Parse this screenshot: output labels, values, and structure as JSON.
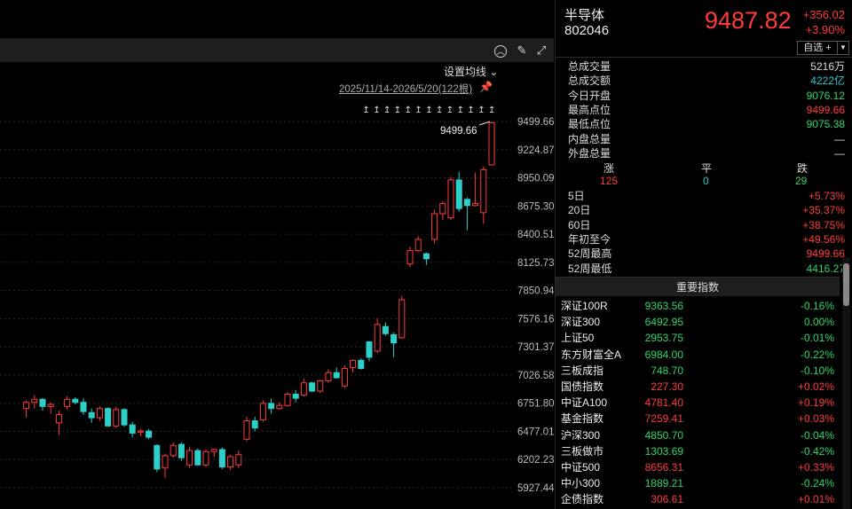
{
  "toolbar": {
    "collapse_icon": "collapse-up-icon",
    "draw_icon": "draw-pen-icon",
    "expand_icon": "expand-icon",
    "ma_setting_label": "设置均线",
    "date_range": "2025/11/14-2026/5/20(122根)"
  },
  "quote": {
    "name": "半导体",
    "code": "802046",
    "price": "9487.82",
    "change": "+356.02",
    "change_pct": "+3.90%",
    "watch_label": "自选 +",
    "watch_drop": "▼"
  },
  "stats": [
    {
      "label": "总成交量",
      "value": "5216万",
      "color": "flat"
    },
    {
      "label": "总成交额",
      "value": "4222亿",
      "color": "cyan"
    },
    {
      "label": "今日开盘",
      "value": "9076.12",
      "color": "down"
    },
    {
      "label": "最高点位",
      "value": "9499.66",
      "color": "up"
    },
    {
      "label": "最低点位",
      "value": "9075.38",
      "color": "down"
    },
    {
      "label": "内盘总量",
      "value": "—",
      "color": "flat"
    },
    {
      "label": "外盘总量",
      "value": "—",
      "color": "flat"
    }
  ],
  "breadth": {
    "up_label": "涨",
    "up_value": "125",
    "flat_label": "平",
    "flat_value": "0",
    "down_label": "跌",
    "down_value": "29"
  },
  "performance": [
    {
      "label": "5日",
      "value": "+5.73%",
      "color": "up"
    },
    {
      "label": "20日",
      "value": "+35.37%",
      "color": "up"
    },
    {
      "label": "60日",
      "value": "+38.75%",
      "color": "up"
    },
    {
      "label": "年初至今",
      "value": "+49.56%",
      "color": "up"
    },
    {
      "label": "52周最高",
      "value": "9499.66",
      "color": "up"
    },
    {
      "label": "52周最低",
      "value": "4416.27",
      "color": "down"
    }
  ],
  "indices_header": "重要指数",
  "indices": [
    {
      "name": "深证100R",
      "price": "9363.56",
      "change": "-0.16%",
      "color": "down"
    },
    {
      "name": "深证300",
      "price": "6492.95",
      "change": "0.00%",
      "color": "down"
    },
    {
      "name": "上证50",
      "price": "2953.75",
      "change": "-0.01%",
      "color": "down"
    },
    {
      "name": "东方财富全A",
      "price": "6984.00",
      "change": "-0.22%",
      "color": "down"
    },
    {
      "name": "三板成指",
      "price": "748.70",
      "change": "-0.10%",
      "color": "down"
    },
    {
      "name": "国债指数",
      "price": "227.30",
      "change": "+0.02%",
      "color": "up"
    },
    {
      "name": "中证A100",
      "price": "4781.40",
      "change": "+0.19%",
      "color": "up"
    },
    {
      "name": "基金指数",
      "price": "7259.41",
      "change": "+0.03%",
      "color": "up"
    },
    {
      "name": "沪深300",
      "price": "4850.70",
      "change": "-0.04%",
      "color": "down"
    },
    {
      "name": "三板做市",
      "price": "1303.69",
      "change": "-0.42%",
      "color": "down"
    },
    {
      "name": "中证500",
      "price": "8656.31",
      "change": "+0.33%",
      "color": "up"
    },
    {
      "name": "中小300",
      "price": "1889.21",
      "change": "-0.24%",
      "color": "down"
    },
    {
      "name": "企债指数",
      "price": "306.61",
      "change": "+0.01%",
      "color": "up"
    }
  ],
  "colors": {
    "up": "#ff3b3b",
    "down": "#2cd0c8",
    "grid": "#2a2a2a",
    "axis_text": "#bbbbbb"
  },
  "chart_data": {
    "type": "candlestick",
    "y_ticks": [
      9499.66,
      9224.87,
      8950.09,
      8675.3,
      8400.51,
      8125.73,
      7850.94,
      7576.16,
      7301.37,
      7026.58,
      6751.8,
      6477.01,
      6202.23,
      5927.44
    ],
    "ylim": [
      5880,
      9560
    ],
    "high_marker": "9499.66",
    "candles": [
      {
        "o": 6700,
        "h": 6780,
        "l": 6610,
        "c": 6760
      },
      {
        "o": 6760,
        "h": 6830,
        "l": 6700,
        "c": 6790
      },
      {
        "o": 6790,
        "h": 6800,
        "l": 6680,
        "c": 6720
      },
      {
        "o": 6720,
        "h": 6760,
        "l": 6650,
        "c": 6740
      },
      {
        "o": 6560,
        "h": 6680,
        "l": 6440,
        "c": 6640
      },
      {
        "o": 6720,
        "h": 6820,
        "l": 6690,
        "c": 6790
      },
      {
        "o": 6790,
        "h": 6810,
        "l": 6740,
        "c": 6760
      },
      {
        "o": 6760,
        "h": 6800,
        "l": 6640,
        "c": 6670
      },
      {
        "o": 6660,
        "h": 6700,
        "l": 6560,
        "c": 6610
      },
      {
        "o": 6610,
        "h": 6720,
        "l": 6580,
        "c": 6700
      },
      {
        "o": 6700,
        "h": 6710,
        "l": 6520,
        "c": 6530
      },
      {
        "o": 6530,
        "h": 6720,
        "l": 6510,
        "c": 6690
      },
      {
        "o": 6690,
        "h": 6700,
        "l": 6520,
        "c": 6540
      },
      {
        "o": 6540,
        "h": 6570,
        "l": 6420,
        "c": 6460
      },
      {
        "o": 6470,
        "h": 6500,
        "l": 6430,
        "c": 6480
      },
      {
        "o": 6480,
        "h": 6500,
        "l": 6400,
        "c": 6420
      },
      {
        "o": 6340,
        "h": 6350,
        "l": 6080,
        "c": 6110
      },
      {
        "o": 6120,
        "h": 6260,
        "l": 6020,
        "c": 6240
      },
      {
        "o": 6240,
        "h": 6370,
        "l": 6220,
        "c": 6340
      },
      {
        "o": 6350,
        "h": 6370,
        "l": 6190,
        "c": 6220
      },
      {
        "o": 6150,
        "h": 6330,
        "l": 6120,
        "c": 6290
      },
      {
        "o": 6290,
        "h": 6310,
        "l": 6140,
        "c": 6150
      },
      {
        "o": 6150,
        "h": 6300,
        "l": 6130,
        "c": 6280
      },
      {
        "o": 6280,
        "h": 6310,
        "l": 6230,
        "c": 6300
      },
      {
        "o": 6300,
        "h": 6320,
        "l": 6110,
        "c": 6130
      },
      {
        "o": 6130,
        "h": 6250,
        "l": 6100,
        "c": 6230
      },
      {
        "o": 6150,
        "h": 6290,
        "l": 6120,
        "c": 6250
      },
      {
        "o": 6400,
        "h": 6620,
        "l": 6380,
        "c": 6580
      },
      {
        "o": 6580,
        "h": 6620,
        "l": 6480,
        "c": 6510
      },
      {
        "o": 6590,
        "h": 6780,
        "l": 6570,
        "c": 6750
      },
      {
        "o": 6750,
        "h": 6800,
        "l": 6650,
        "c": 6700
      },
      {
        "o": 6700,
        "h": 6760,
        "l": 6690,
        "c": 6730
      },
      {
        "o": 6730,
        "h": 6860,
        "l": 6720,
        "c": 6840
      },
      {
        "o": 6840,
        "h": 6880,
        "l": 6760,
        "c": 6800
      },
      {
        "o": 6830,
        "h": 6990,
        "l": 6820,
        "c": 6950
      },
      {
        "o": 6950,
        "h": 6960,
        "l": 6860,
        "c": 6870
      },
      {
        "o": 6870,
        "h": 6980,
        "l": 6850,
        "c": 6970
      },
      {
        "o": 6970,
        "h": 7080,
        "l": 6950,
        "c": 7050
      },
      {
        "o": 7050,
        "h": 7100,
        "l": 6990,
        "c": 7000
      },
      {
        "o": 6920,
        "h": 7120,
        "l": 6900,
        "c": 7090
      },
      {
        "o": 7100,
        "h": 7180,
        "l": 7050,
        "c": 7170
      },
      {
        "o": 7170,
        "h": 7190,
        "l": 7080,
        "c": 7090
      },
      {
        "o": 7350,
        "h": 7360,
        "l": 7160,
        "c": 7200
      },
      {
        "o": 7260,
        "h": 7580,
        "l": 7240,
        "c": 7520
      },
      {
        "o": 7500,
        "h": 7540,
        "l": 7410,
        "c": 7430
      },
      {
        "o": 7420,
        "h": 7440,
        "l": 7200,
        "c": 7340
      },
      {
        "o": 7390,
        "h": 7800,
        "l": 7380,
        "c": 7760
      },
      {
        "o": 8110,
        "h": 8280,
        "l": 8080,
        "c": 8240
      },
      {
        "o": 8240,
        "h": 8380,
        "l": 8230,
        "c": 8350
      },
      {
        "o": 8210,
        "h": 8220,
        "l": 8100,
        "c": 8160
      },
      {
        "o": 8350,
        "h": 8640,
        "l": 8310,
        "c": 8600
      },
      {
        "o": 8600,
        "h": 8720,
        "l": 8540,
        "c": 8700
      },
      {
        "o": 8560,
        "h": 8960,
        "l": 8540,
        "c": 8930
      },
      {
        "o": 8930,
        "h": 9010,
        "l": 8620,
        "c": 8650
      },
      {
        "o": 8740,
        "h": 8760,
        "l": 8440,
        "c": 8680
      },
      {
        "o": 8680,
        "h": 9000,
        "l": 8670,
        "c": 8700
      },
      {
        "o": 8610,
        "h": 9060,
        "l": 8500,
        "c": 9030
      },
      {
        "o": 9076.12,
        "h": 9499.66,
        "l": 9075.38,
        "c": 9487.82
      }
    ]
  }
}
